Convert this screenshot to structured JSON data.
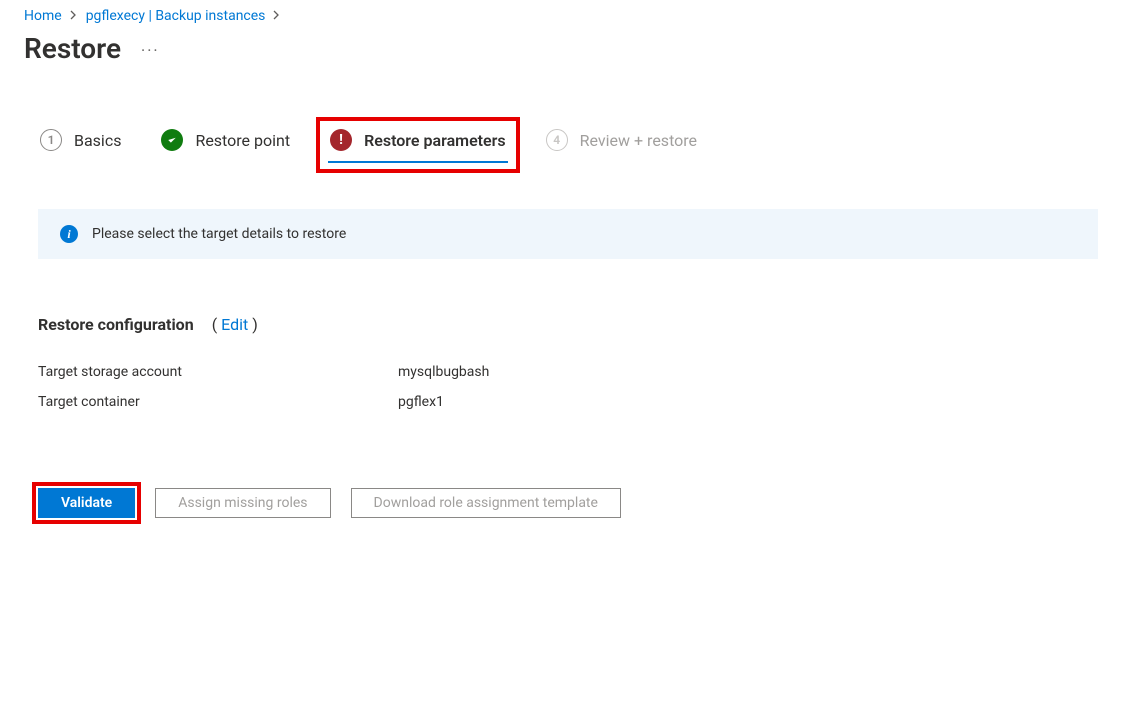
{
  "breadcrumb": {
    "home": "Home",
    "resource": "pgflexecy | Backup instances"
  },
  "page": {
    "title": "Restore"
  },
  "wizard": {
    "step1": {
      "number": "1",
      "label": "Basics"
    },
    "step2": {
      "label": "Restore point"
    },
    "step3": {
      "label": "Restore parameters"
    },
    "step4": {
      "number": "4",
      "label": "Review + restore"
    }
  },
  "info": {
    "message": "Please select the target details to restore"
  },
  "section": {
    "heading": "Restore configuration",
    "edit_prefix": "( ",
    "edit": "Edit",
    "edit_suffix": " )"
  },
  "details": {
    "storage_label": "Target storage account",
    "storage_value": "mysqlbugbash",
    "container_label": "Target container",
    "container_value": "pgflex1"
  },
  "buttons": {
    "validate": "Validate",
    "assign_roles": "Assign missing roles",
    "download_template": "Download role assignment template"
  }
}
